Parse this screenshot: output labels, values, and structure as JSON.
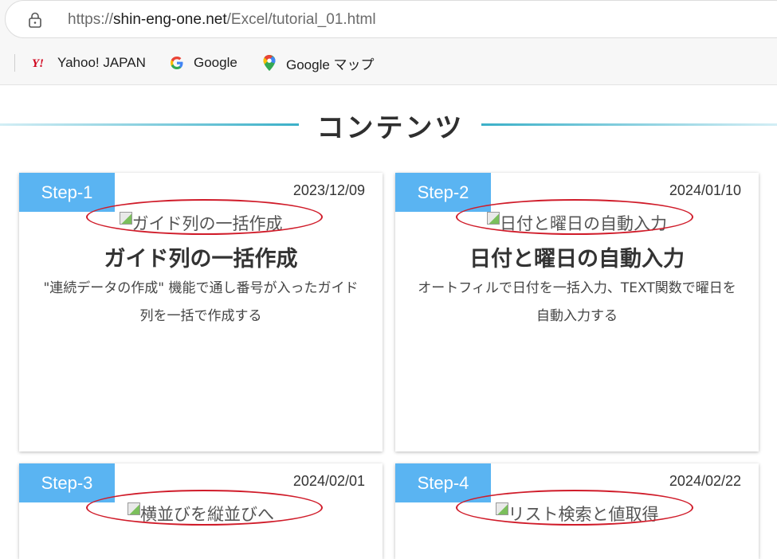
{
  "browser": {
    "url_prefix": "https://",
    "url_host": "shin-eng-one.net",
    "url_path": "/Excel/tutorial_01.html",
    "bookmarks": [
      {
        "label": "Yahoo! JAPAN",
        "icon": "yahoo-icon"
      },
      {
        "label": "Google",
        "icon": "google-icon"
      },
      {
        "label": "Google マップ",
        "icon": "google-maps-icon"
      }
    ]
  },
  "section": {
    "heading": "コンテンツ",
    "accent_color": "#3bb0c8"
  },
  "cards": [
    {
      "step": "Step-1",
      "date": "2023/12/09",
      "image_alt": "ガイド列の一括作成",
      "title": "ガイド列の一括作成",
      "description": "\"連続データの作成\" 機能で通し番号が入ったガイド列を一括で作成する"
    },
    {
      "step": "Step-2",
      "date": "2024/01/10",
      "image_alt": "日付と曜日の自動入力",
      "title": "日付と曜日の自動入力",
      "description": "オートフィルで日付を一括入力、TEXT関数で曜日を自動入力する"
    },
    {
      "step": "Step-3",
      "date": "2024/02/01",
      "image_alt": "横並びを縦並びへ"
    },
    {
      "step": "Step-4",
      "date": "2024/02/22",
      "image_alt": "リスト検索と値取得"
    }
  ],
  "colors": {
    "badge": "#5ab4f2",
    "annotation": "#d01c2a"
  }
}
